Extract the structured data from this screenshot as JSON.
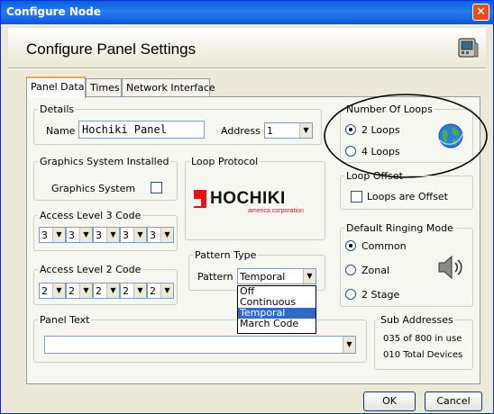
{
  "window": {
    "title": "Configure Node",
    "close_glyph": "✕"
  },
  "header": {
    "title": "Configure Panel Settings",
    "icon": "panel-device-icon"
  },
  "tabs": [
    {
      "label": "Panel Data",
      "active": true
    },
    {
      "label": "Times",
      "active": false
    },
    {
      "label": "Network Interface",
      "active": false
    }
  ],
  "details": {
    "legend": "Details",
    "name_label": "Name",
    "name_value": "Hochiki Panel",
    "address_label": "Address",
    "address_value": "1"
  },
  "loops": {
    "legend": "Number Of Loops",
    "options": [
      "2 Loops",
      "4 Loops"
    ],
    "selected": "2 Loops",
    "icon": "globe-icon"
  },
  "graphics": {
    "legend": "Graphics System Installed",
    "checkbox_label": "Graphics System",
    "checked": false
  },
  "loop_protocol": {
    "legend": "Loop Protocol",
    "logo_text": "HOCHIKI",
    "logo_subtext": "america corporation",
    "logo_color": "#e11414"
  },
  "loop_offset": {
    "legend": "Loop Offset",
    "checkbox_label": "Loops are Offset",
    "checked": false
  },
  "access3": {
    "legend": "Access Level 3 Code",
    "digits": [
      "3",
      "3",
      "3",
      "3",
      "3"
    ]
  },
  "access2": {
    "legend": "Access Level 2 Code",
    "digits": [
      "2",
      "2",
      "2",
      "2",
      "2"
    ]
  },
  "pattern": {
    "legend": "Pattern Type",
    "label": "Pattern",
    "value": "Temporal",
    "options": [
      "Off",
      "Continuous",
      "Temporal",
      "March Code"
    ],
    "highlighted": "Temporal"
  },
  "ringing": {
    "legend": "Default Ringing Mode",
    "options": [
      "Common",
      "Zonal",
      "2 Stage"
    ],
    "selected": "Common",
    "icon": "speaker-icon"
  },
  "panel_text": {
    "legend": "Panel Text",
    "value": ""
  },
  "sub_addresses": {
    "legend": "Sub Addresses",
    "in_use": "035 of 800  in use",
    "total": "010 Total Devices"
  },
  "buttons": {
    "ok": "OK",
    "cancel": "Cancel"
  },
  "colors": {
    "title_bar": "#0a5ee0",
    "selection": "#316ac5",
    "close": "#e04e1b"
  }
}
